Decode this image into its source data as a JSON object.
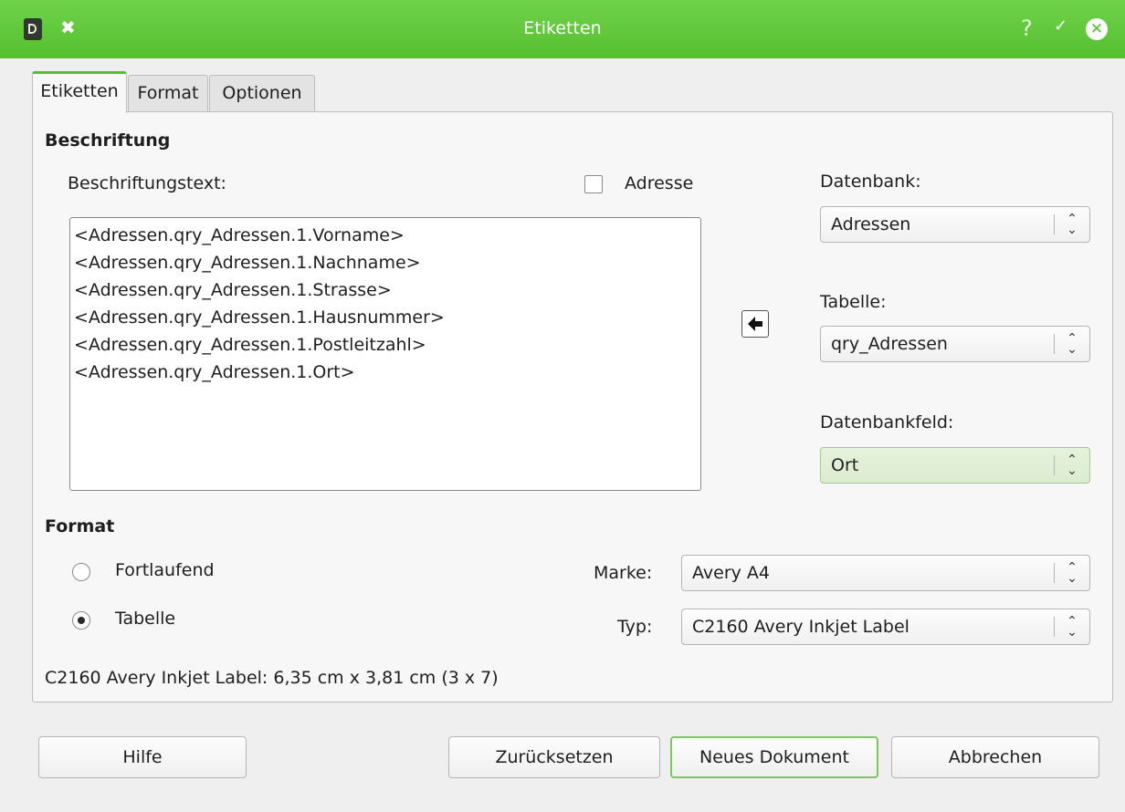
{
  "window": {
    "title": "Etiketten",
    "help_glyph": "?",
    "accent": "#55c02f"
  },
  "tabs": [
    {
      "label": "Etiketten",
      "active": true
    },
    {
      "label": "Format",
      "active": false
    },
    {
      "label": "Optionen",
      "active": false
    }
  ],
  "beschriftung": {
    "heading": "Beschriftung",
    "text_label": "Beschriftungstext:",
    "address_checkbox_label": "Adresse",
    "address_checked": false,
    "lines": [
      "<Adressen.qry_Adressen.1.Vorname>",
      "<Adressen.qry_Adressen.1.Nachname>",
      "<Adressen.qry_Adressen.1.Strasse>",
      "<Adressen.qry_Adressen.1.Hausnummer>",
      "<Adressen.qry_Adressen.1.Postleitzahl>",
      "<Adressen.qry_Adressen.1.Ort>"
    ]
  },
  "database": {
    "db_label": "Datenbank:",
    "db_value": "Adressen",
    "table_label": "Tabelle:",
    "table_value": "qry_Adressen",
    "field_label": "Datenbankfeld:",
    "field_value": "Ort"
  },
  "format": {
    "heading": "Format",
    "continuous_label": "Fortlaufend",
    "table_label": "Tabelle",
    "selected": "Tabelle",
    "brand_label": "Marke:",
    "brand_value": "Avery A4",
    "type_label": "Typ:",
    "type_value": "C2160 Avery Inkjet Label",
    "info": "C2160 Avery Inkjet Label: 6,35 cm x 3,81 cm (3 x 7)"
  },
  "buttons": {
    "help": "Hilfe",
    "reset": "Zurücksetzen",
    "new_document": "Neues Dokument",
    "cancel": "Abbrechen"
  },
  "icons": [
    "document-icon",
    "pin-icon",
    "help-icon",
    "chevron-down-icon",
    "close-icon",
    "arrow-left-icon",
    "spin-updown-icon"
  ]
}
